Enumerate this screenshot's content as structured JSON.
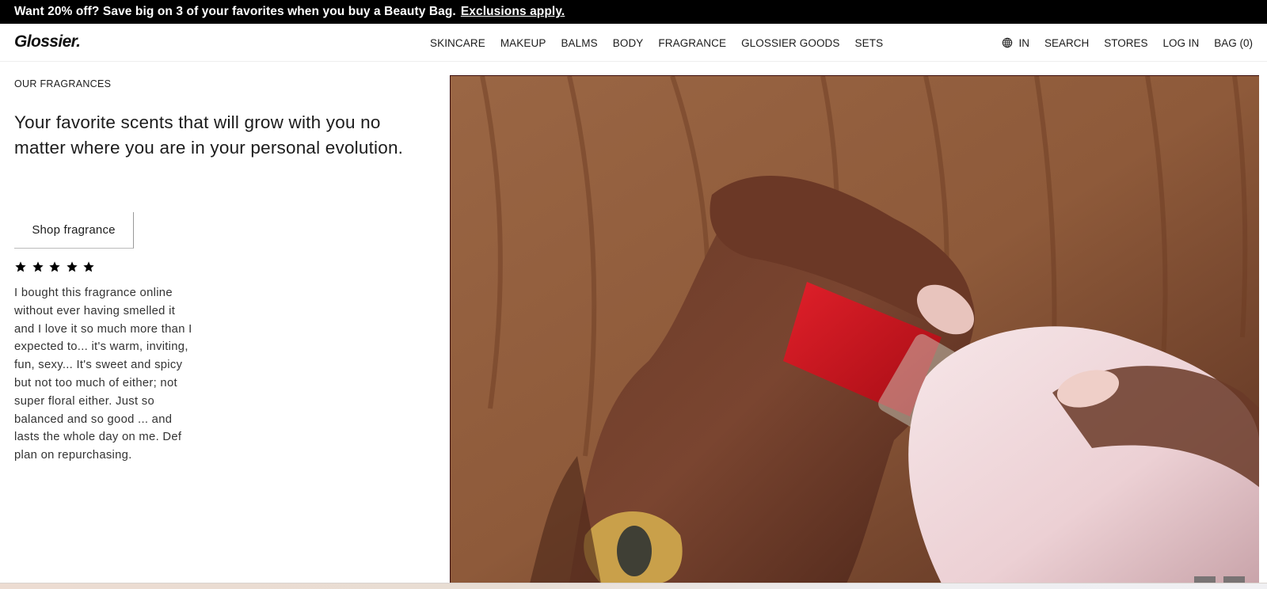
{
  "promo": {
    "text": "Want 20% off? Save big on 3 of your favorites when you buy a Beauty Bag.",
    "link_label": "Exclusions apply."
  },
  "header": {
    "logo": "Glossier.",
    "nav": [
      {
        "label": "SKINCARE"
      },
      {
        "label": "MAKEUP"
      },
      {
        "label": "BALMS"
      },
      {
        "label": "BODY"
      },
      {
        "label": "FRAGRANCE"
      },
      {
        "label": "GLOSSIER GOODS"
      },
      {
        "label": "SETS"
      }
    ],
    "utility": {
      "locale_icon": "globe-icon",
      "locale": "IN",
      "search": "SEARCH",
      "stores": "STORES",
      "login": "LOG IN",
      "bag": "BAG (0)"
    }
  },
  "hero": {
    "eyebrow": "OUR FRAGRANCES",
    "headline": "Your favorite scents that will grow with you no matter where you are in your personal evolution.",
    "cta_label": "Shop fragrance",
    "rating": {
      "value": 5,
      "max": 5,
      "icon": "star-icon"
    },
    "review": "I bought this fragrance online without ever having smelled it and I love it so much more than I expected to... it's warm, inviting, fun, sexy... It's sweet and spicy but not too much of either; not super floral either. Just so balanced and so good ... and lasts the whole day on me. Def plan on repurchasing.",
    "image_alt": "Hand holding a pink Glossier fragrance bottle with red cap against a brown ribbed sweater",
    "carousel": {
      "slides": 2
    }
  },
  "colors": {
    "promo_bg": "#000000",
    "text": "#1c1c1c",
    "sweater": "#8b5a3a",
    "cap_red": "#d0121b",
    "bottle_pink": "#f1d9dc"
  }
}
